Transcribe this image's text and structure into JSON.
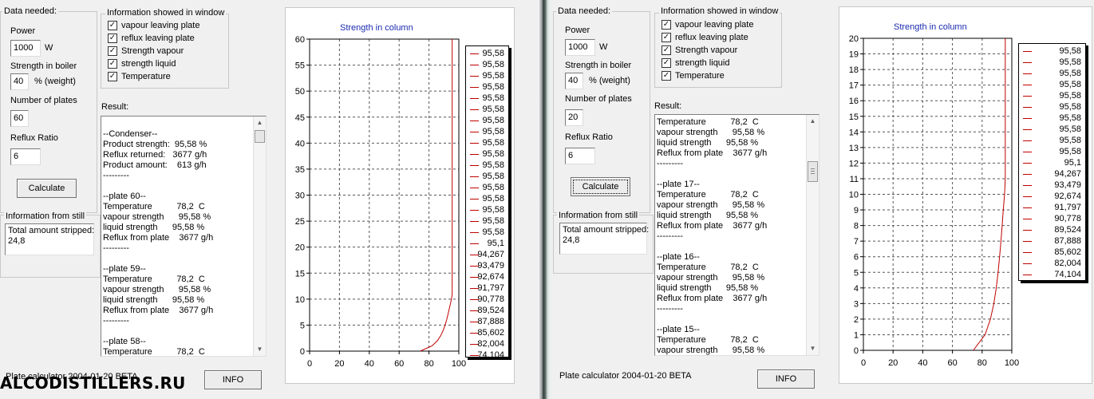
{
  "watermark": "ALCODISTILLERS.RU",
  "panels": [
    {
      "id": "left",
      "data_needed": {
        "title": "Data needed:",
        "power_label": "Power",
        "power_value": "1000",
        "power_unit": "W",
        "strength_label": "Strength in  boiler",
        "strength_value": "40",
        "strength_unit": "% (weight)",
        "plates_label": "Number of plates",
        "plates_value": "60",
        "reflux_label": "Reflux Ratio",
        "reflux_value": "6",
        "calculate_label": "Calculate"
      },
      "info_window": {
        "title": "Information showed in window",
        "options": [
          {
            "label": "vapour leaving plate",
            "checked": "✓"
          },
          {
            "label": "reflux leaving plate",
            "checked": "✓"
          },
          {
            "label": "Strength vapour",
            "checked": "✓"
          },
          {
            "label": "strength liquid",
            "checked": "✓"
          },
          {
            "label": "Temperature",
            "checked": "✓"
          }
        ]
      },
      "result_label": "Result:",
      "result_text": "\n--Condenser--\nProduct strength:  95,58 %\nReflux returned:   3677 g/h\nProduct amount:    613 g/h\n---------\n\n--plate 60--\nTemperature          78,2  C\nvapour strength      95,58 %\nliquid strength      95,58 %\nReflux from plate    3677 g/h\n---------\n\n--plate 59--\nTemperature          78,2  C\nvapour strength      95,58 %\nliquid strength      95,58 %\nReflux from plate    3677 g/h\n---------\n\n--plate 58--\nTemperature          78,2  C",
      "still": {
        "title": "Information from still",
        "text": "Total amount stripped:\n24,8"
      },
      "status": "Plate calculator 2004-01-20 BETA",
      "info_button": "INFO"
    },
    {
      "id": "right",
      "data_needed": {
        "title": "Data needed:",
        "power_label": "Power",
        "power_value": "1000",
        "power_unit": "W",
        "strength_label": "Strength in  boiler",
        "strength_value": "40",
        "strength_unit": "% (weight)",
        "plates_label": "Number of plates",
        "plates_value": "20",
        "reflux_label": "Reflux Ratio",
        "reflux_value": "6",
        "calculate_label": "Calculate"
      },
      "info_window": {
        "title": "Information showed in window",
        "options": [
          {
            "label": "vapour leaving plate",
            "checked": "✓"
          },
          {
            "label": "reflux leaving plate",
            "checked": "✓"
          },
          {
            "label": "Strength vapour",
            "checked": "✓"
          },
          {
            "label": "strength liquid",
            "checked": "✓"
          },
          {
            "label": "Temperature",
            "checked": "✓"
          }
        ]
      },
      "result_label": "Result:",
      "result_text": "Temperature          78,2  C\nvapour strength      95,58 %\nliquid strength      95,58 %\nReflux from plate    3677 g/h\n---------\n\n--plate 17--\nTemperature          78,2  C\nvapour strength      95,58 %\nliquid strength      95,58 %\nReflux from plate    3677 g/h\n---------\n\n--plate 16--\nTemperature          78,2  C\nvapour strength      95,58 %\nliquid strength      95,58 %\nReflux from plate    3677 g/h\n---------\n\n--plate 15--\nTemperature          78,2  C\nvapour strength      95,58 %",
      "still": {
        "title": "Information from still",
        "text": "Total amount stripped:\n24,8"
      },
      "status": "Plate calculator 2004-01-20 BETA",
      "info_button": "INFO"
    }
  ],
  "chart_data": [
    {
      "type": "line",
      "title": "Strength in column",
      "xlabel": "",
      "ylabel": "",
      "xlim": [
        0,
        100
      ],
      "ylim": [
        0,
        60
      ],
      "x_ticks": [
        0,
        20,
        40,
        60,
        80,
        100
      ],
      "y_ticks": [
        0,
        5,
        10,
        15,
        20,
        25,
        30,
        35,
        40,
        45,
        50,
        55,
        60
      ],
      "grid": true,
      "legend_position": "right",
      "line_color": "#c00000",
      "legend_values": [
        "95,58",
        "95,58",
        "95,58",
        "95,58",
        "95,58",
        "95,58",
        "95,58",
        "95,58",
        "95,58",
        "95,58",
        "95,58",
        "95,58",
        "95,58",
        "95,58",
        "95,58",
        "95,58",
        "95,58",
        "95,1",
        "94,267",
        "93,479",
        "92,674",
        "91,797",
        "90,778",
        "89,524",
        "87,888",
        "85,602",
        "82,004",
        "74,104"
      ],
      "series": [
        {
          "x": [
            74.104,
            82.004,
            85.602,
            87.888,
            89.524,
            90.778,
            91.797,
            92.674,
            93.479,
            94.267,
            95.1,
            95.58,
            95.58
          ],
          "y": [
            0,
            1,
            2,
            3,
            4,
            5,
            6,
            7,
            8,
            9,
            10,
            11,
            60
          ]
        }
      ]
    },
    {
      "type": "line",
      "title": "Strength in column",
      "xlabel": "",
      "ylabel": "",
      "xlim": [
        0,
        100
      ],
      "ylim": [
        0,
        20
      ],
      "x_ticks": [
        0,
        20,
        40,
        60,
        80,
        100
      ],
      "y_ticks": [
        0,
        1,
        2,
        3,
        4,
        5,
        6,
        7,
        8,
        9,
        10,
        11,
        12,
        13,
        14,
        15,
        16,
        17,
        18,
        19,
        20
      ],
      "grid": true,
      "legend_position": "right",
      "line_color": "#c00000",
      "legend_values": [
        "95,58",
        "95,58",
        "95,58",
        "95,58",
        "95,58",
        "95,58",
        "95,58",
        "95,58",
        "95,58",
        "95,58",
        "95,1",
        "94,267",
        "93,479",
        "92,674",
        "91,797",
        "90,778",
        "89,524",
        "87,888",
        "85,602",
        "82,004",
        "74,104"
      ],
      "series": [
        {
          "x": [
            74.104,
            82.004,
            85.602,
            87.888,
            89.524,
            90.778,
            91.797,
            92.674,
            93.479,
            94.267,
            95.1,
            95.58,
            95.58
          ],
          "y": [
            0,
            1,
            2,
            3,
            4,
            5,
            6,
            7,
            8,
            9,
            10,
            11,
            20
          ]
        }
      ]
    }
  ]
}
